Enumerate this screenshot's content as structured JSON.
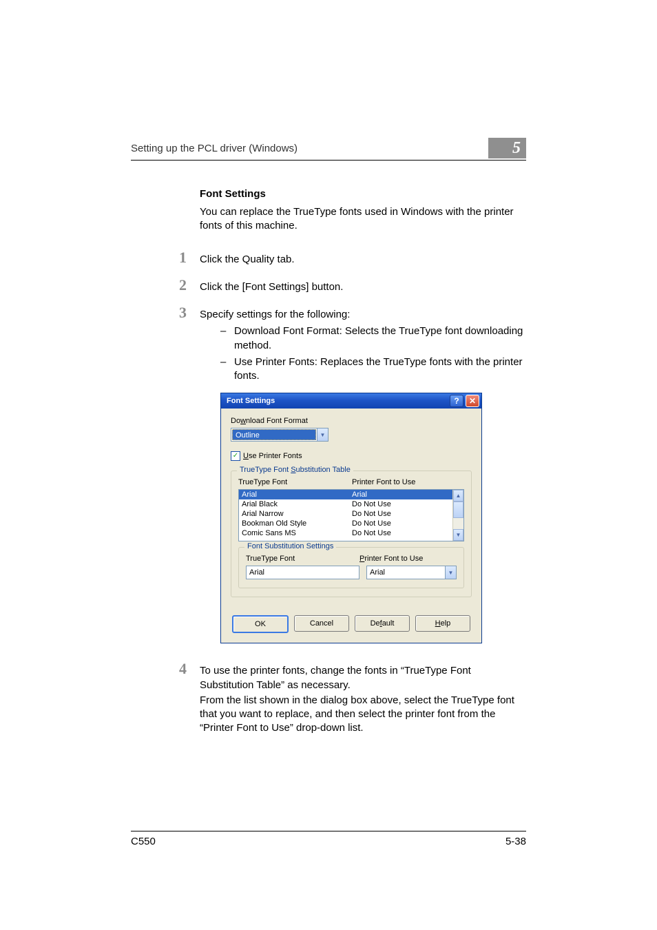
{
  "runhead": {
    "title": "Setting up the PCL driver (Windows)",
    "chapter": "5"
  },
  "heading": "Font Settings",
  "intro": "You can replace the TrueType fonts used in Windows with the printer fonts of this machine.",
  "steps": [
    {
      "num": "1",
      "text": "Click the Quality tab."
    },
    {
      "num": "2",
      "text": "Click the [Font Settings] button."
    },
    {
      "num": "3",
      "text": "Specify settings for the following:",
      "subs": [
        "Download Font Format: Selects the TrueType font downloading method.",
        "Use Printer Fonts: Replaces the TrueType fonts with the printer fonts."
      ]
    },
    {
      "num": "4",
      "text": "To use the printer fonts, change the fonts in “TrueType Font Substitution Table” as necessary.",
      "follow": "From the list shown in the dialog box above, select the TrueType font that you want to replace, and then select the printer font from the “Printer Font to Use” drop-down list."
    }
  ],
  "dialog": {
    "title": "Font Settings",
    "download_label_pre": "Do",
    "download_label_ul": "w",
    "download_label_post": "nload Font Format",
    "download_value": "Outline",
    "use_printer_ul": "U",
    "use_printer_rest": "se Printer Fonts",
    "use_printer_checked": true,
    "subst_legend_pre": "TrueType Font ",
    "subst_legend_ul": "S",
    "subst_legend_post": "ubstitution Table",
    "col1": "TrueType Font",
    "col2": "Printer Font to Use",
    "rows": [
      {
        "tt": "Arial",
        "pf": "Arial",
        "selected": true
      },
      {
        "tt": "Arial Black",
        "pf": "Do Not Use",
        "selected": false
      },
      {
        "tt": "Arial Narrow",
        "pf": "Do Not Use",
        "selected": false
      },
      {
        "tt": "Bookman Old Style",
        "pf": "Do Not Use",
        "selected": false
      },
      {
        "tt": "Comic Sans MS",
        "pf": "Do Not Use",
        "selected": false
      }
    ],
    "inner_legend": "Font Substitution Settings",
    "inner_col1": "TrueType Font",
    "inner_col2_ul": "P",
    "inner_col2_rest": "rinter Font to Use",
    "tf_value": "Arial",
    "pf_value": "Arial",
    "buttons": {
      "ok": "OK",
      "cancel": "Cancel",
      "default_pre": "De",
      "default_ul": "f",
      "default_post": "ault",
      "help_ul": "H",
      "help_rest": "elp"
    }
  },
  "footer": {
    "left": "C550",
    "right": "5-38"
  }
}
